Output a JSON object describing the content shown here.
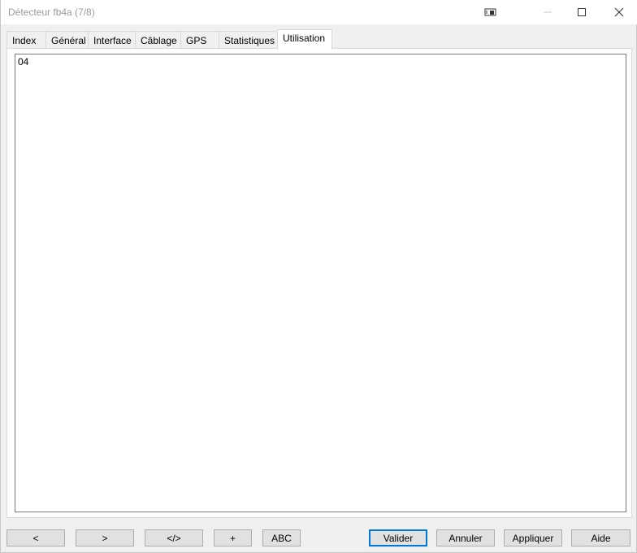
{
  "window": {
    "title": "Détecteur fb4a (7/8)"
  },
  "tabs": [
    {
      "label": "Index"
    },
    {
      "label": "Général"
    },
    {
      "label": "Interface"
    },
    {
      "label": "Câblage"
    },
    {
      "label": "GPS"
    },
    {
      "label": "Statistiques"
    },
    {
      "label": "Utilisation"
    }
  ],
  "active_tab": "Utilisation",
  "content": {
    "text": "04"
  },
  "buttons": {
    "prev": "<",
    "next": ">",
    "code": "</>",
    "plus": "+",
    "abc": "ABC",
    "valider": "Valider",
    "annuler": "Annuler",
    "appliquer": "Appliquer",
    "aide": "Aide"
  },
  "icons": {
    "extra": "window-pin-icon",
    "minimize": "minimize-icon",
    "maximize": "maximize-icon",
    "close": "close-icon"
  },
  "colors": {
    "default_button_border": "#0078d7"
  }
}
